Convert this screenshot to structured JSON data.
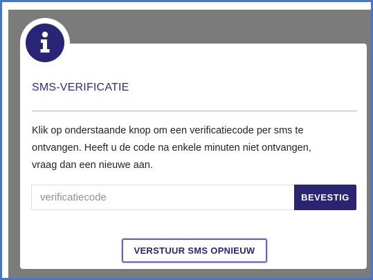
{
  "icons": {
    "info": "info-icon"
  },
  "dialog": {
    "title": "SMS-VERIFICATIE",
    "body_line_1": "Klik op onderstaande knop om een verificatiecode per sms te",
    "body_line_2": "ontvangen. Heeft u de code na enkele minuten niet ontvangen,",
    "body_line_3": "vraag dan een nieuwe aan.",
    "code_input": {
      "placeholder": "verificatiecode",
      "value": ""
    },
    "confirm_label": "BEVESTIG",
    "resend_label": "VERSTUUR SMS OPNIEUW"
  },
  "colors": {
    "frame_border": "#4a74c9",
    "overlay": "#7b7b7b",
    "primary": "#2a2475",
    "title": "#2f2a86",
    "divider": "#a7b9d8"
  }
}
